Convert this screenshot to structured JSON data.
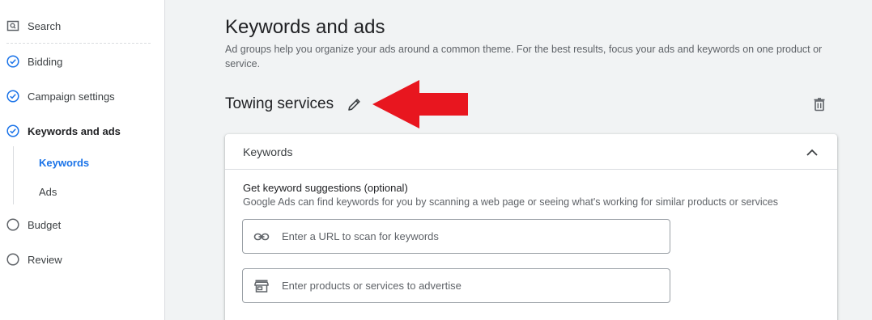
{
  "sidebar": {
    "search_label": "Search",
    "items": [
      {
        "label": "Bidding",
        "status": "complete"
      },
      {
        "label": "Campaign settings",
        "status": "complete"
      },
      {
        "label": "Keywords and ads",
        "status": "active"
      },
      {
        "label": "Budget",
        "status": "incomplete"
      },
      {
        "label": "Review",
        "status": "incomplete"
      }
    ],
    "subitems": [
      {
        "label": "Keywords",
        "active": true
      },
      {
        "label": "Ads",
        "active": false
      }
    ]
  },
  "main": {
    "title": "Keywords and ads",
    "description": "Ad groups help you organize your ads around a common theme. For the best results, focus your ads and keywords on one product or service.",
    "ad_group_name": "Towing services",
    "card": {
      "title": "Keywords",
      "suggestions_title": "Get keyword suggestions (optional)",
      "suggestions_desc": "Google Ads can find keywords for you by scanning a web page or seeing what's working for similar products or services",
      "url_field": {
        "value": "",
        "placeholder": "Enter a URL to scan for keywords"
      },
      "products_field": {
        "value": "",
        "placeholder": "Enter products or services to advertise"
      }
    }
  },
  "colors": {
    "accent": "#1a73e8",
    "annotation_arrow": "#e8161f"
  }
}
